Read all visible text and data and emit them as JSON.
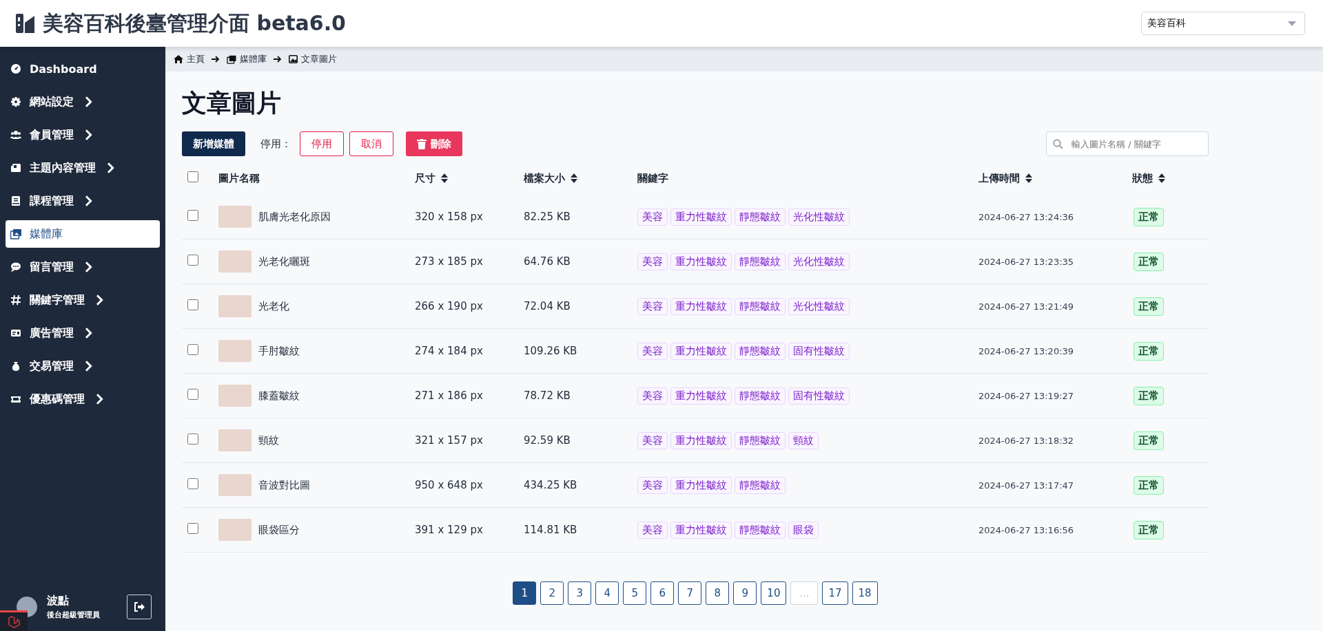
{
  "header": {
    "title": "美容百科後臺管理介面 beta6.0",
    "site_select": {
      "value": "美容百科"
    }
  },
  "sidebar": {
    "items": [
      {
        "label": "Dashboard",
        "expandable": false,
        "selected": false
      },
      {
        "label": "網站設定",
        "expandable": true,
        "selected": false
      },
      {
        "label": "會員管理",
        "expandable": true,
        "selected": false
      },
      {
        "label": "主題內容管理",
        "expandable": true,
        "selected": false
      },
      {
        "label": "課程管理",
        "expandable": true,
        "selected": false
      },
      {
        "label": "媒體庫",
        "expandable": false,
        "selected": true
      },
      {
        "label": "留言管理",
        "expandable": true,
        "selected": false
      },
      {
        "label": "關鍵字管理",
        "expandable": true,
        "selected": false
      },
      {
        "label": "廣告管理",
        "expandable": true,
        "selected": false
      },
      {
        "label": "交易管理",
        "expandable": true,
        "selected": false
      },
      {
        "label": "優惠碼管理",
        "expandable": true,
        "selected": false
      }
    ],
    "user": {
      "name": "波點",
      "role": "後台超級管理員"
    }
  },
  "breadcrumb": [
    "主頁",
    "媒體庫",
    "文章圖片"
  ],
  "page_title": "文章圖片",
  "toolbar": {
    "add_button": "新增媒體",
    "disable_label": "停用：",
    "disable_button": "停用",
    "cancel_button": "取消",
    "delete_button": "刪除",
    "search": {
      "placeholder": "輸入圖片名稱 / 關鍵字"
    }
  },
  "table": {
    "select_all": {
      "checked": false
    },
    "columns": [
      {
        "label": "圖片名稱",
        "sortable": false
      },
      {
        "label": "尺寸",
        "sortable": true
      },
      {
        "label": "檔案大小",
        "sortable": true
      },
      {
        "label": "關鍵字",
        "sortable": false
      },
      {
        "label": "上傳時間",
        "sortable": true
      },
      {
        "label": "狀態",
        "sortable": true
      }
    ],
    "rows": [
      {
        "checked": false,
        "name": "肌膚光老化原因",
        "size": "320 x 158 px",
        "file_size": "82.25 KB",
        "keywords": [
          "美容",
          "重力性皺紋",
          "靜態皺紋",
          "光化性皺紋"
        ],
        "uploaded": "2024-06-27 13:24:36",
        "status": "正常"
      },
      {
        "checked": false,
        "name": "光老化曬斑",
        "size": "273 x 185 px",
        "file_size": "64.76 KB",
        "keywords": [
          "美容",
          "重力性皺紋",
          "靜態皺紋",
          "光化性皺紋"
        ],
        "uploaded": "2024-06-27 13:23:35",
        "status": "正常"
      },
      {
        "checked": false,
        "name": "光老化",
        "size": "266 x 190 px",
        "file_size": "72.04 KB",
        "keywords": [
          "美容",
          "重力性皺紋",
          "靜態皺紋",
          "光化性皺紋"
        ],
        "uploaded": "2024-06-27 13:21:49",
        "status": "正常"
      },
      {
        "checked": false,
        "name": "手肘皺紋",
        "size": "274 x 184 px",
        "file_size": "109.26 KB",
        "keywords": [
          "美容",
          "重力性皺紋",
          "靜態皺紋",
          "固有性皺紋"
        ],
        "uploaded": "2024-06-27 13:20:39",
        "status": "正常"
      },
      {
        "checked": false,
        "name": "膝蓋皺紋",
        "size": "271 x 186 px",
        "file_size": "78.72 KB",
        "keywords": [
          "美容",
          "重力性皺紋",
          "靜態皺紋",
          "固有性皺紋"
        ],
        "uploaded": "2024-06-27 13:19:27",
        "status": "正常"
      },
      {
        "checked": false,
        "name": "頸紋",
        "size": "321 x 157 px",
        "file_size": "92.59 KB",
        "keywords": [
          "美容",
          "重力性皺紋",
          "靜態皺紋",
          "頸紋"
        ],
        "uploaded": "2024-06-27 13:18:32",
        "status": "正常"
      },
      {
        "checked": false,
        "name": "音波對比圖",
        "size": "950 x 648 px",
        "file_size": "434.25 KB",
        "keywords": [
          "美容",
          "重力性皺紋",
          "靜態皺紋"
        ],
        "uploaded": "2024-06-27 13:17:47",
        "status": "正常"
      },
      {
        "checked": false,
        "name": "眼袋區分",
        "size": "391 x 129 px",
        "file_size": "114.81 KB",
        "keywords": [
          "美容",
          "重力性皺紋",
          "靜態皺紋",
          "眼袋"
        ],
        "uploaded": "2024-06-27 13:16:56",
        "status": "正常"
      }
    ]
  },
  "pagination": [
    {
      "kind": "page",
      "label": "1",
      "selected": true
    },
    {
      "kind": "page",
      "label": "2",
      "selected": false
    },
    {
      "kind": "page",
      "label": "3",
      "selected": false
    },
    {
      "kind": "page",
      "label": "4",
      "selected": false
    },
    {
      "kind": "page",
      "label": "5",
      "selected": false
    },
    {
      "kind": "page",
      "label": "6",
      "selected": false
    },
    {
      "kind": "page",
      "label": "7",
      "selected": false
    },
    {
      "kind": "page",
      "label": "8",
      "selected": false
    },
    {
      "kind": "page",
      "label": "9",
      "selected": false
    },
    {
      "kind": "page",
      "label": "10",
      "selected": false
    },
    {
      "kind": "ellipsis",
      "label": "..."
    },
    {
      "kind": "page",
      "label": "17",
      "selected": false
    },
    {
      "kind": "page",
      "label": "18",
      "selected": false
    }
  ]
}
